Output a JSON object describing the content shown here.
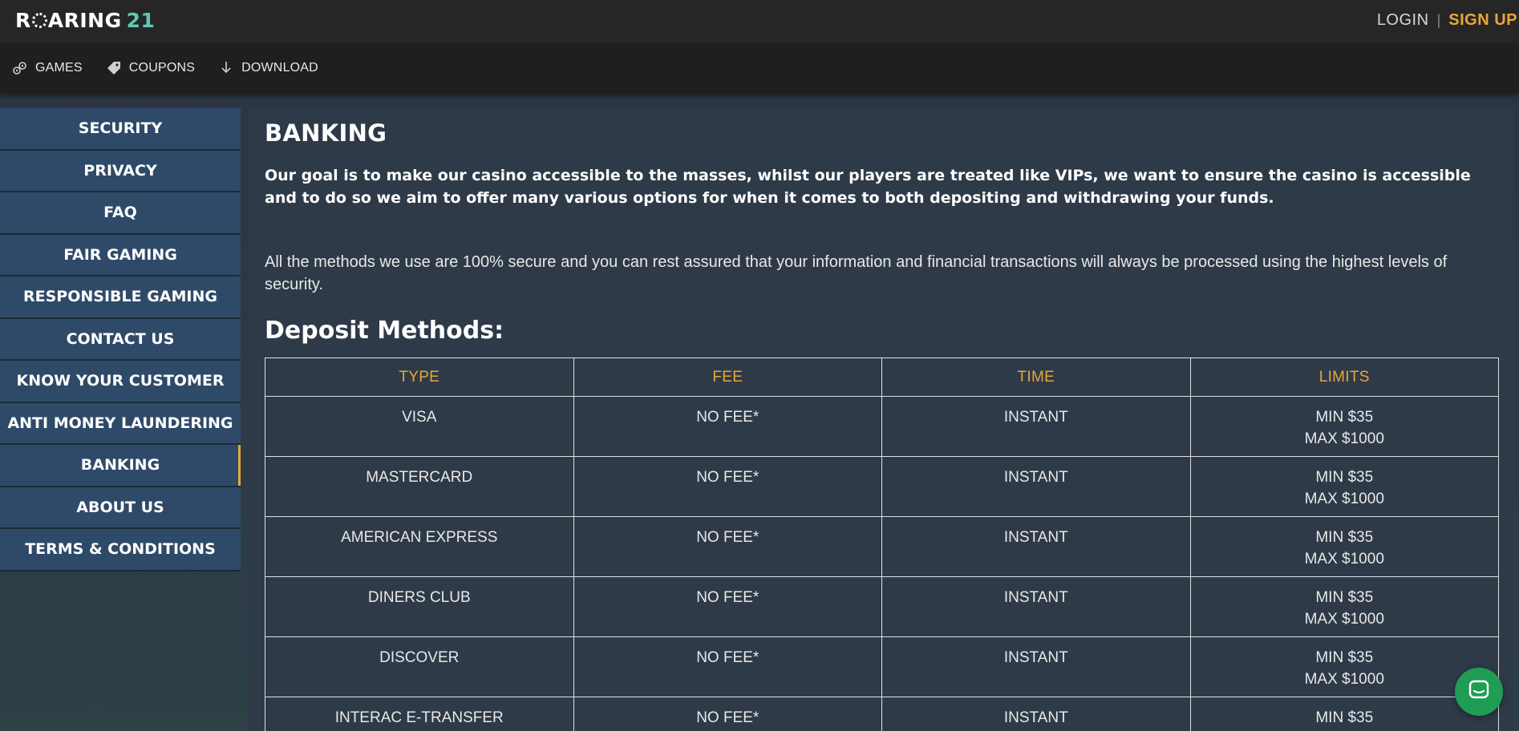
{
  "header": {
    "logo_text": "ROARING",
    "logo_number": "21",
    "login_label": "LOGIN",
    "separator": "|",
    "signup_label": "SIGN UP"
  },
  "nav": {
    "items": [
      {
        "label": "GAMES",
        "icon": "gamepad-icon"
      },
      {
        "label": "COUPONS",
        "icon": "coupon-icon"
      },
      {
        "label": "DOWNLOAD",
        "icon": "download-icon"
      }
    ]
  },
  "sidebar": {
    "items": [
      {
        "label": "SECURITY"
      },
      {
        "label": "PRIVACY"
      },
      {
        "label": "FAQ"
      },
      {
        "label": "FAIR GAMING"
      },
      {
        "label": "RESPONSIBLE GAMING"
      },
      {
        "label": "CONTACT US"
      },
      {
        "label": "KNOW YOUR CUSTOMER"
      },
      {
        "label": "ANTI MONEY LAUNDERING"
      },
      {
        "label": "BANKING",
        "active": true
      },
      {
        "label": "ABOUT US"
      },
      {
        "label": "TERMS & CONDITIONS"
      }
    ]
  },
  "main": {
    "title": "BANKING",
    "lead": "Our goal is to make our casino accessible to the masses, whilst our players are treated like VIPs, we want to ensure the casino is accessible and to do so we aim to offer many various options for when it comes to both depositing and withdrawing your funds.",
    "body": "All the methods we use are 100% secure and you can rest assured that your information and financial transactions will always be processed using the highest levels of security.",
    "deposit_heading": "Deposit Methods:",
    "table": {
      "headers": [
        "TYPE",
        "FEE",
        "TIME",
        "LIMITS"
      ],
      "rows": [
        {
          "type": "VISA",
          "fee": "NO FEE*",
          "time": "INSTANT",
          "min": "MIN $35",
          "max": "MAX $1000"
        },
        {
          "type": "MASTERCARD",
          "fee": "NO FEE*",
          "time": "INSTANT",
          "min": "MIN $35",
          "max": "MAX $1000"
        },
        {
          "type": "AMERICAN EXPRESS",
          "fee": "NO FEE*",
          "time": "INSTANT",
          "min": "MIN $35",
          "max": "MAX $1000"
        },
        {
          "type": "DINERS CLUB",
          "fee": "NO FEE*",
          "time": "INSTANT",
          "min": "MIN $35",
          "max": "MAX $1000"
        },
        {
          "type": "DISCOVER",
          "fee": "NO FEE*",
          "time": "INSTANT",
          "min": "MIN $35",
          "max": "MAX $1000"
        },
        {
          "type": "INTERAC E-TRANSFER",
          "fee": "NO FEE*",
          "time": "INSTANT",
          "min": "MIN $35",
          "max": ""
        }
      ]
    }
  },
  "colors": {
    "accent": "#e6a63a",
    "sidebar_bg": "#2f4a68",
    "content_bg": "#2f3a48",
    "logo_number": "#5fcab4",
    "chat_button": "#1f9d54"
  },
  "chat": {
    "icon": "chat-icon"
  }
}
